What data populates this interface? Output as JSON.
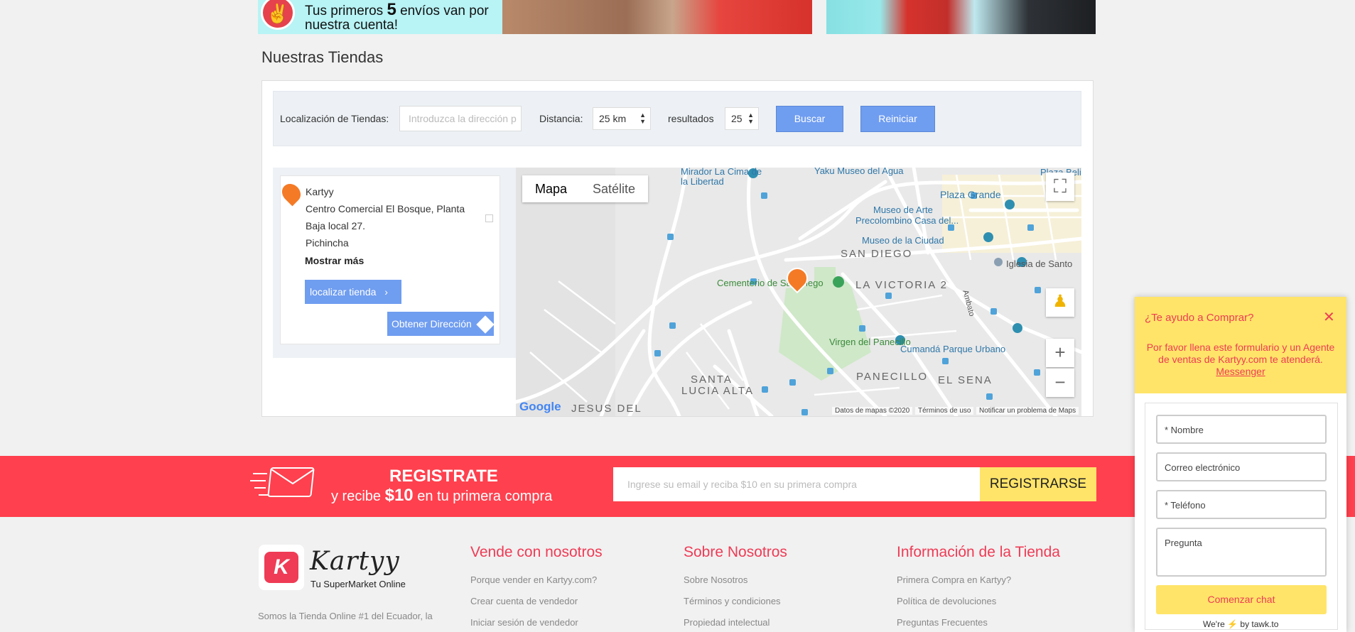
{
  "banner": {
    "promo_prefix": "Tus primeros",
    "promo_number": "5",
    "promo_suffix": "envíos van por",
    "promo_line2": "nuestra cuenta!"
  },
  "stores": {
    "title": "Nuestras Tiendas",
    "location_label": "Localización de Tiendas:",
    "address_placeholder": "Introduzca la dirección p",
    "distance_label": "Distancia:",
    "distance_value": "25 km",
    "results_label": "resultados",
    "results_value": "25",
    "search_button": "Buscar",
    "reset_button": "Reiniciar",
    "list": [
      {
        "name": "Kartyy",
        "address_line1": "Centro Comercial El Bosque, Planta",
        "address_line2": "Baja local 27.",
        "province": "Pichincha",
        "more_label": "Mostrar más",
        "locate_button": "localizar tienda",
        "directions_button": "Obtener Dirección"
      }
    ]
  },
  "map": {
    "tab_map": "Mapa",
    "tab_satellite": "Satélite",
    "labels": {
      "mirador": "Mirador La Cima de",
      "mirador2": "la Libertad",
      "yaku": "Yaku Museo del Agua",
      "plaza_beli": "Plaza Beli",
      "plaza_grande": "Plaza Grande",
      "museo_arte": "Museo de Arte",
      "precolombino": "Precolombino Casa del...",
      "museo_ciudad": "Museo de la Ciudad",
      "san_diego": "SAN DIEGO",
      "iglesia": "Iglesia de Santo",
      "cementerio": "Cementerio de San Diego",
      "la_victoria": "LA VICTORIA 2",
      "virgen": "Virgen del Panecillo",
      "cumanda": "Cumandá Parque Urbano",
      "panecillo": "PANECILLO",
      "el_sena": "EL SENA",
      "santa_lucia": "SANTA",
      "santa_lucia2": "LUCIA ALTA",
      "jesus": "JESUS DEL",
      "ambato": "Ambato"
    },
    "footer_data": "Datos de mapas ©2020",
    "footer_terms": "Términos de uso",
    "footer_report": "Notificar un problema de Maps",
    "google": "Google"
  },
  "register": {
    "title": "REGISTRATE",
    "sub_prefix": "y recibe",
    "sub_amount": "$10",
    "sub_suffix": "en tu primera compra",
    "email_placeholder": "Ingrese su email y reciba $10 en su primera compra",
    "button": "REGISTRARSE"
  },
  "footer": {
    "logo_word": "Kartyy",
    "logo_letter": "K",
    "tagline": "Tu SuperMarket Online",
    "about": "Somos la Tienda Online #1 del Ecuador, la",
    "columns": [
      {
        "title": "Vende con nosotros",
        "links": [
          "Porque vender en Kartyy.com?",
          "Crear cuenta de vendedor",
          "Iniciar sesión de vendedor"
        ]
      },
      {
        "title": "Sobre Nosotros",
        "links": [
          "Sobre Nosotros",
          "Términos y condiciones",
          "Propiedad intelectual"
        ]
      },
      {
        "title": "Información de la Tienda",
        "links": [
          "Primera Compra en Kartyy?",
          "Política de devoluciones",
          "Preguntas Frecuentes"
        ]
      }
    ]
  },
  "chat": {
    "title": "¿Te ayudo a Comprar?",
    "close": "✕",
    "message": "Por favor llena este formulario y un Agente de ventas de Kartyy.com te atenderá.",
    "messenger_link": "Messenger",
    "field_name": "* Nombre",
    "field_email": "Correo electrónico",
    "field_phone": "* Teléfono",
    "field_question": "Pregunta",
    "start_button": "Comenzar chat",
    "powered_prefix": "We're",
    "powered_suffix": "by tawk.to"
  }
}
